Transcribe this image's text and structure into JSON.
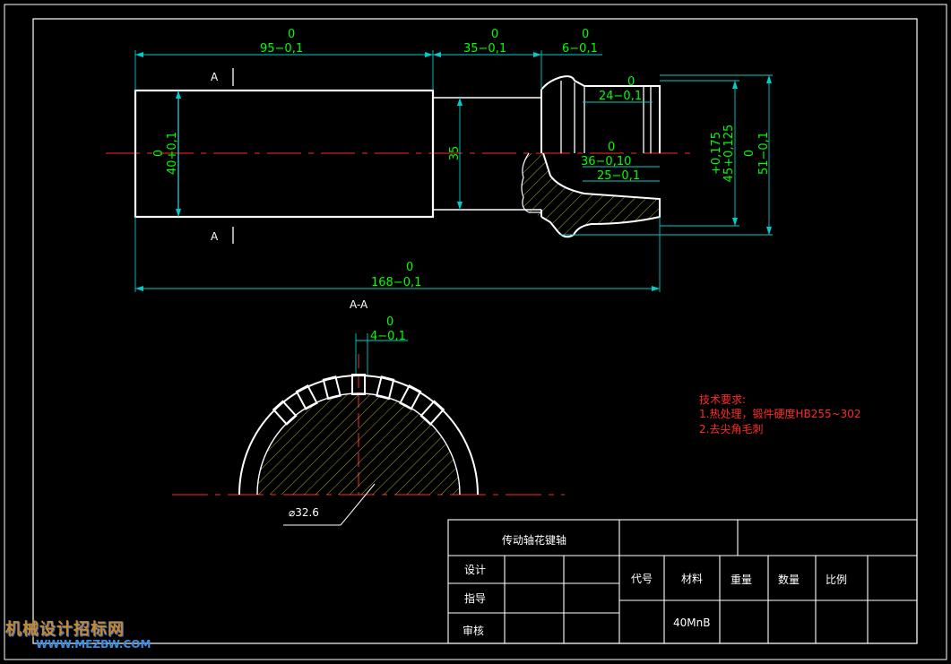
{
  "dims": {
    "d95": {
      "upper": "0",
      "lower": "95−0,1"
    },
    "d35": {
      "upper": "0",
      "lower": "35−0,1"
    },
    "d6": {
      "upper": "0",
      "lower": "6−0,1"
    },
    "d24": {
      "upper": "0",
      "lower": "24−0,1"
    },
    "d36": {
      "upper": "0",
      "lower": "36−0,10"
    },
    "d25": "25−0,1",
    "d40": {
      "upper": "0",
      "lower": "40+0,1"
    },
    "d35v": "35",
    "d45": {
      "upper": "+0,175",
      "lower": "45+0,125"
    },
    "d51": {
      "upper": "0",
      "lower": "51−0,1"
    },
    "d168": {
      "upper": "0",
      "lower": "168−0,1"
    },
    "d4": {
      "upper": "0",
      "lower": "4−0,1"
    },
    "phi": "⌀32.6"
  },
  "section_labels": {
    "a_top": "A",
    "a_bottom": "A",
    "view": "A-A"
  },
  "tech_requirements": {
    "title": "技术要求:",
    "item1": "1.热处理，锻件硬度HB255~302",
    "item2": "2.去尖角毛刺"
  },
  "title_block": {
    "part_name": "传动轴花键轴",
    "design": "设计",
    "guide": "指导",
    "review": "审核",
    "code": "代号",
    "material_label": "材料",
    "weight": "重量",
    "quantity": "数量",
    "scale": "比例",
    "material_value": "40MnB"
  },
  "watermark": {
    "line1": "机械设计招标网",
    "line2": "WWW.MEZBW.COM"
  }
}
